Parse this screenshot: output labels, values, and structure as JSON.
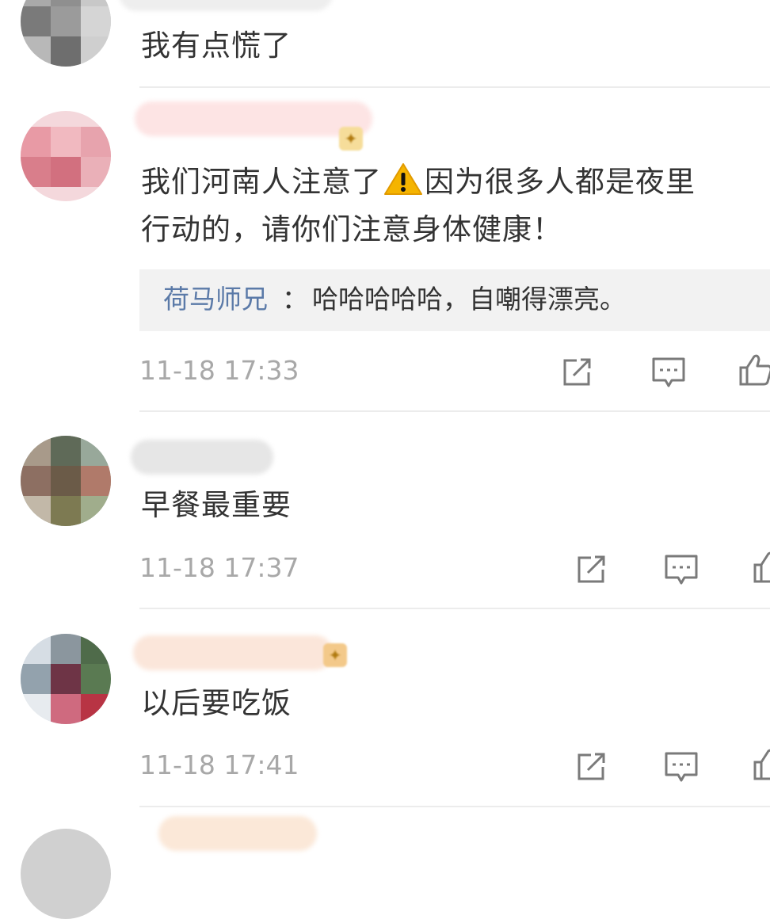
{
  "comments": [
    {
      "text": "我有点慌了"
    },
    {
      "text_line1": "我们河南人注意了",
      "warning_icon": "warning-icon",
      "text_line1_rest": "因为很多人都是夜里",
      "text_line2": "行动的，请你们注意身体健康！",
      "reply": {
        "author": "荷马师兄",
        "separator": "：",
        "text": "哈哈哈哈哈，自嘲得漂亮。"
      },
      "timestamp": "11-18 17:33"
    },
    {
      "text": "早餐最重要",
      "timestamp": "11-18 17:37"
    },
    {
      "text": "以后要吃饭",
      "timestamp": "11-18 17:41"
    }
  ],
  "actions": {
    "forward_icon": "share-icon",
    "comment_icon": "comment-icon",
    "like_icon": "thumbs-up-icon"
  },
  "colors": {
    "text": "#333333",
    "reply_author": "#5b7aa8",
    "timestamp": "#a8a8a8",
    "reply_bg": "#f2f2f2",
    "divider": "#ececec"
  }
}
